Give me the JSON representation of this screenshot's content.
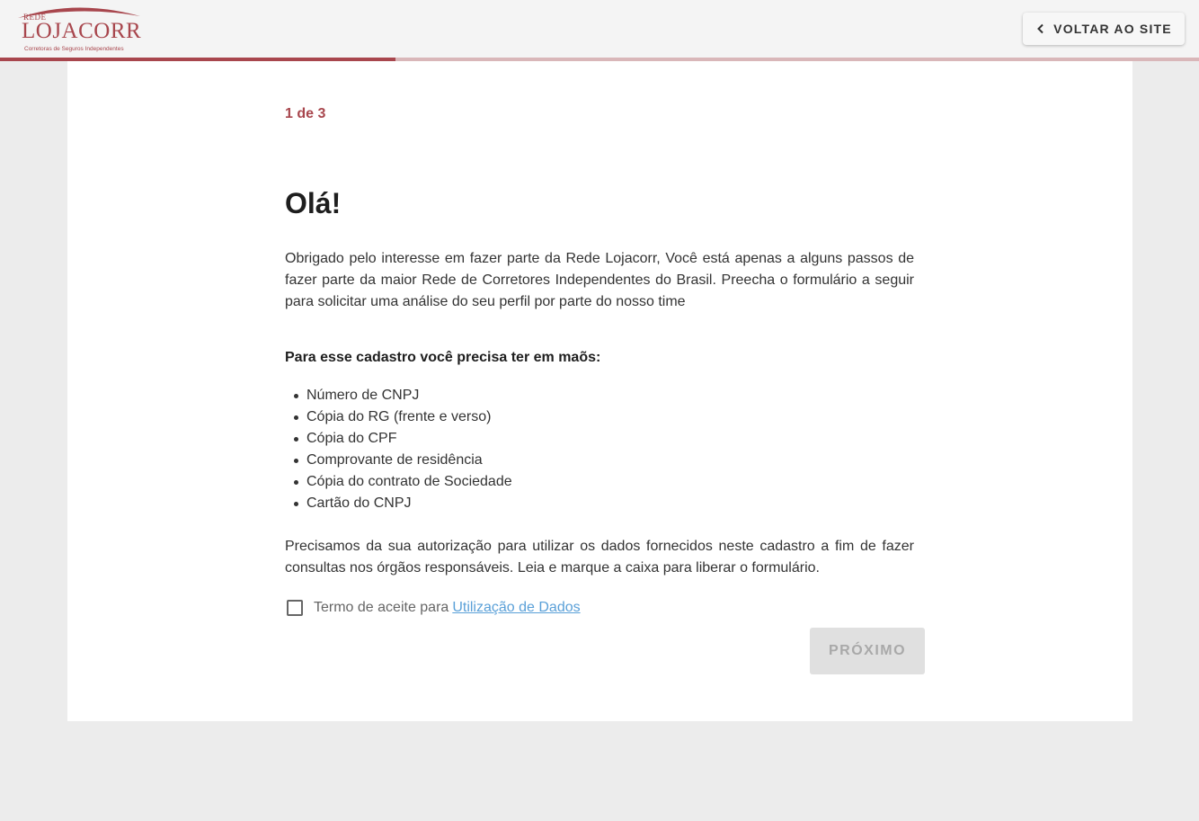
{
  "header": {
    "logo": {
      "top_text": "REDE",
      "brand": "LOJACORR",
      "tagline": "Corretoras de Seguros Independentes"
    },
    "back_button": {
      "label": "VOLTAR AO SITE",
      "icon": "chevron-left-icon"
    }
  },
  "progress": {
    "fraction": 0.33,
    "fill_color": "#a8464d",
    "track_color": "#d9b7b9"
  },
  "form": {
    "step": "1 de 3",
    "title": "Olá!",
    "intro": "Obrigado pelo interesse em fazer parte da Rede Lojacorr, Você está apenas a alguns passos de fazer parte da maior Rede de Corretores Independentes do Brasil. Preecha o formulário a seguir para solicitar uma análise do seu perfil por parte do nosso time",
    "requirements_title": "Para esse cadastro você precisa ter em maõs:",
    "requirements": [
      "Número de CNPJ",
      "Cópia do RG (frente e verso)",
      "Cópia do CPF",
      "Comprovante de residência",
      "Cópia do contrato de Sociedade",
      "Cartão do CNPJ"
    ],
    "consent_text": "Precisamos da sua autorização para utilizar os dados fornecidos neste cadastro a fim de fazer consultas nos órgãos responsáveis. Leia e marque a caixa para liberar o formulário.",
    "terms_label": "Termo de aceite para",
    "terms_link": "Utilização de Dados",
    "terms_checked": false,
    "next_button": {
      "label": "PRÓXIMO",
      "disabled": true
    }
  },
  "colors": {
    "accent": "#a8464d",
    "link": "#5aa0d8",
    "page_bg": "#ececec"
  }
}
